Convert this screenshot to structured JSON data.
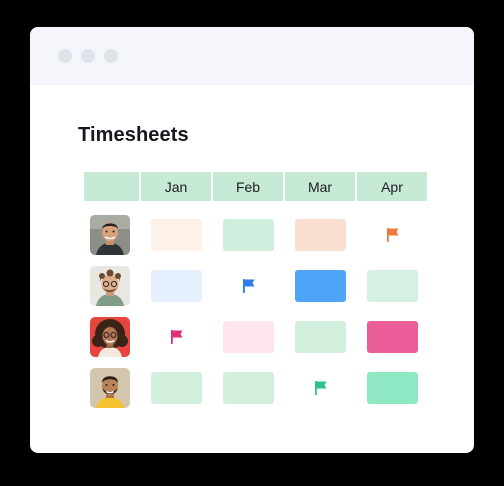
{
  "window": {
    "title": "Timesheets",
    "traffic_lights": [
      "window-dot-1",
      "window-dot-2",
      "window-dot-3"
    ]
  },
  "table": {
    "columns": [
      "",
      "Jan",
      "Feb",
      "Mar",
      "Apr"
    ],
    "rows": [
      {
        "avatar": "man-short-hair",
        "cells": [
          {
            "type": "block",
            "color": "#fdf1ea"
          },
          {
            "type": "block",
            "color": "#cfeedd"
          },
          {
            "type": "block",
            "color": "#fbe0d1"
          },
          {
            "type": "flag",
            "color": "#f07a3c"
          }
        ]
      },
      {
        "avatar": "man-curly-hair-glasses",
        "cells": [
          {
            "type": "block",
            "color": "#e6f0ff"
          },
          {
            "type": "flag",
            "color": "#2b7de9"
          },
          {
            "type": "block",
            "color": "#4ea5f8"
          },
          {
            "type": "block",
            "color": "#d5f1e1"
          }
        ]
      },
      {
        "avatar": "woman-curly-hair-glasses",
        "cells": [
          {
            "type": "flag",
            "color": "#e0307a"
          },
          {
            "type": "block",
            "color": "#fde6f0"
          },
          {
            "type": "block",
            "color": "#d3f0df"
          },
          {
            "type": "block",
            "color": "#ea5d98"
          }
        ]
      },
      {
        "avatar": "man-beard-yellow-shirt",
        "cells": [
          {
            "type": "block",
            "color": "#d3f0df"
          },
          {
            "type": "block",
            "color": "#d3f0df"
          },
          {
            "type": "flag",
            "color": "#2cc38a"
          },
          {
            "type": "block",
            "color": "#8ee8c4"
          }
        ]
      }
    ]
  }
}
